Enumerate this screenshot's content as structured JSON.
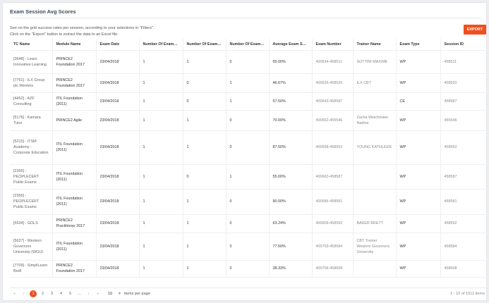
{
  "panel": {
    "title": "Exam Session Avg Scores",
    "description_line1": "See on the grid success rates per session, according to your selections in \"Filters\".",
    "description_line2": "Click on the \"Export\" button to extract the data to an Excel file.",
    "export_label": "EXPORT"
  },
  "columns": [
    "TC Name",
    "Module Name",
    "Exam Date",
    "Number Of Exams ...",
    "Number Of Exams ...",
    "Number Of Exams ...",
    "Average Exam Sco...",
    "Exam Number",
    "Trainer Name",
    "Exam Type",
    "Session ID"
  ],
  "rows": [
    [
      "[3648] - Learn Innovative Learning",
      "PRINCE2 Foundation 2017",
      "23/04/2018",
      "1",
      "1",
      "0",
      "65.00%",
      "400634-458511",
      "SOTTINI MAXIME",
      "WP",
      "458511"
    ],
    [
      "[7761] - ILX Group plc Wexters",
      "PRINCE2 Foundation 2017",
      "23/04/2018",
      "1",
      "0",
      "1",
      "46.67%",
      "400626-458520",
      "ILX CBT",
      "WP",
      "458520"
    ],
    [
      "[4452] - AZF Consulting",
      "ITIL Foundation (2011)",
      "23/04/2018",
      "1",
      "0",
      "1",
      "57.50%",
      "400643-458587",
      "",
      "CE",
      "458587"
    ],
    [
      "[5176] - Kamara Tutor",
      "PRINCE2 Agile",
      "23/04/2018",
      "1",
      "1",
      "0",
      "70.00%",
      "400652-455546",
      "Zacha Weichmaier Nadine",
      "WP",
      "455546"
    ],
    [
      "[5215] - ITSM Academy - Corporate Education",
      "ITIL Foundation (2011)",
      "23/04/2018",
      "1",
      "1",
      "0",
      "87.50%",
      "400658-458552",
      "YOUNG KATHLEEN",
      "WP",
      "458552"
    ],
    [
      "[2356] - PEOPLECERT Public Exams",
      "ITIL Foundation (2011)",
      "23/04/2018",
      "1",
      "0",
      "1",
      "55.00%",
      "400663-458587",
      "",
      "WP",
      "458587"
    ],
    [
      "[2356] - PEOPLECERT Public Exams",
      "ITIL Foundation (2011)",
      "23/04/2018",
      "1",
      "1",
      "0",
      "90.00%",
      "400686-458581",
      "",
      "WP",
      "458581"
    ],
    [
      "[5534] - GOLS",
      "PRINCE2 Practitioner 2017",
      "23/04/2018",
      "1",
      "1",
      "0",
      "63.24%",
      "400609-458592",
      "BAKER BRETT",
      "WP",
      "458592"
    ],
    [
      "[5627] - Western Governors University (WGU)",
      "ITIL Foundation (2011)",
      "23/04/2018",
      "1",
      "1",
      "0",
      "77.50%",
      "400703-458584",
      "CBT Trainer Western Governors University",
      "WP",
      "458584"
    ],
    [
      "[7709] - SimpliLearn Bedf",
      "PRINCE2 Foundation 2017",
      "23/04/2018",
      "1",
      "1",
      "0",
      "38.33%",
      "400706-458608",
      "",
      "WP",
      "458608"
    ]
  ],
  "pager": {
    "first": "«",
    "prev": "‹",
    "pages": [
      "1",
      "2",
      "3",
      "4",
      "5",
      "..."
    ],
    "active_page": "1",
    "next": "›",
    "last": "»",
    "per_page_value": "10",
    "per_page_label": "items per page",
    "range_text": "1 - 10 of 1011 items"
  },
  "colors": {
    "accent": "#f04f1e",
    "title": "#3c4a5c"
  }
}
